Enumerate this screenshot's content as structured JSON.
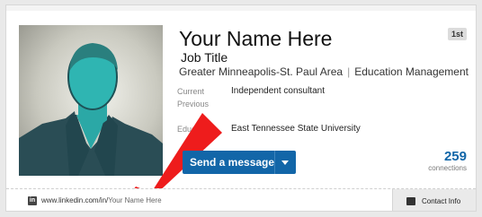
{
  "profile": {
    "name": "Your Name Here",
    "job_title": "Job Title",
    "location": "Greater Minneapolis-St. Paul Area",
    "industry": "Education Management",
    "degree_badge": "1st"
  },
  "details": {
    "current_label": "Current",
    "current_value": "Independent consultant",
    "previous_label": "Previous",
    "education_label": "Education",
    "education_value": "East Tennessee State University"
  },
  "actions": {
    "send_message_label": "Send a message"
  },
  "connections": {
    "count": "259",
    "label": "connections"
  },
  "footer": {
    "linkedin_icon_text": "in",
    "url_prefix": "www.linkedin.com/in/",
    "url_name": "Your Name Here",
    "contact_info_label": "Contact Info"
  },
  "annotation": {
    "arrow_color": "#ee1c1c"
  }
}
